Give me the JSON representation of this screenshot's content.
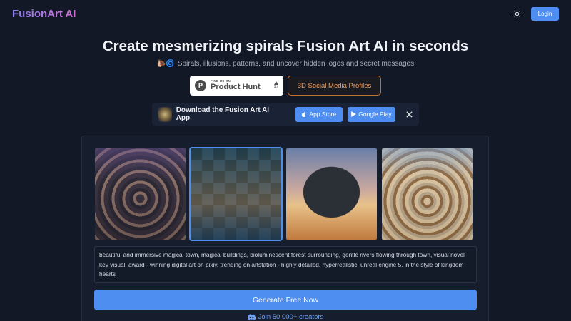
{
  "header": {
    "logo": "FusionArt AI",
    "login_label": "Login",
    "theme_icon": "sun-icon"
  },
  "hero": {
    "title": "Create mesmerizing spirals Fusion Art AI in seconds",
    "subtitle_emoji": "🐌🌀",
    "subtitle": "Spirals, illusions, patterns, and uncover hidden logos and secret messages"
  },
  "badges": {
    "product_hunt": {
      "letter": "P",
      "small": "FIND US ON",
      "big": "Product Hunt",
      "votes": "17"
    },
    "social_label": "3D Social Media Profiles"
  },
  "app_bar": {
    "label": "Download the Fusion Art AI App",
    "app_store_label": "App Store",
    "google_play_label": "Google Play"
  },
  "gallery": {
    "selected_index": 1,
    "items": [
      "spiral-town",
      "checker-forest-town",
      "floating-rock-bird",
      "spiral-castle"
    ]
  },
  "prompt": {
    "text": "beautiful and immersive magical town, magical buildings, bioluminescent forest surrounding, gentle rivers flowing through town, visual novel key visual, award - winning digital art on pixiv, trending on artstation - highly detailed, hyperrealistic, unreal engine 5, in the style of kingdom hearts"
  },
  "generate_label": "Generate Free Now",
  "discord_label": "Join 50,000+ creators",
  "colors": {
    "accent": "#4d8ef0",
    "background": "#121826",
    "social_border": "#c2722c"
  }
}
